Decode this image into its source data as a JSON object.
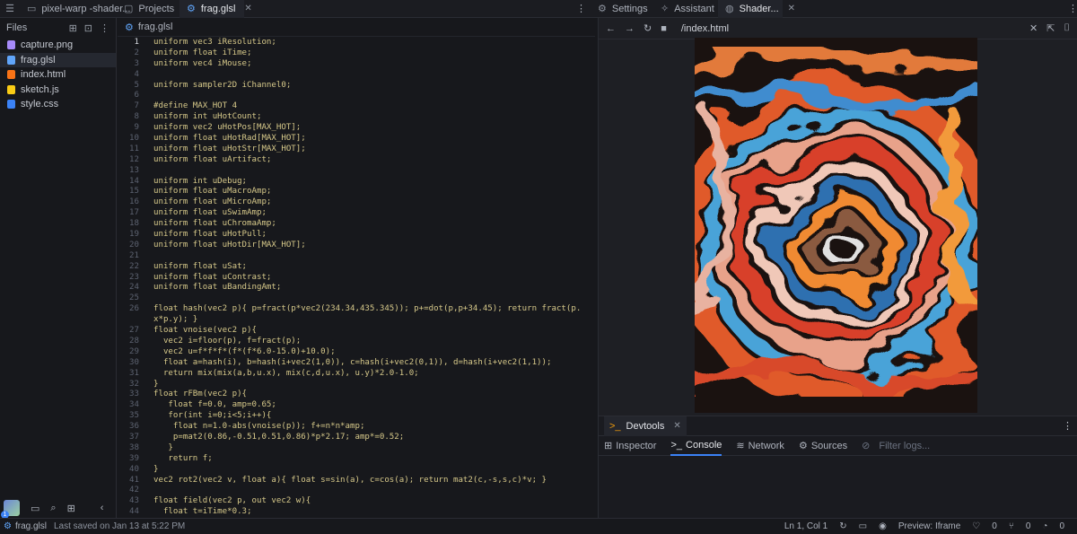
{
  "topbar": {
    "project_tab": "pixel-warp -shader...",
    "projects_tab": "Projects",
    "file_tab": "frag.glsl",
    "settings_tab": "Settings",
    "assistant_tab": "Assistant",
    "shader_tab": "Shader..."
  },
  "sidebar": {
    "title": "Files",
    "files": [
      {
        "name": "capture.png",
        "color": "#a78bfa"
      },
      {
        "name": "frag.glsl",
        "color": "#60a5fa"
      },
      {
        "name": "index.html",
        "color": "#f97316"
      },
      {
        "name": "sketch.js",
        "color": "#facc15"
      },
      {
        "name": "style.css",
        "color": "#3b82f6"
      }
    ],
    "avatar_badge": "1"
  },
  "editor": {
    "breadcrumb": "frag.glsl",
    "lines": [
      {
        "n": "1",
        "t": "uniform vec3 iResolution;"
      },
      {
        "n": "2",
        "t": "uniform float iTime;"
      },
      {
        "n": "3",
        "t": "uniform vec4 iMouse;"
      },
      {
        "n": "4",
        "t": ""
      },
      {
        "n": "5",
        "t": "uniform sampler2D iChannel0;"
      },
      {
        "n": "6",
        "t": ""
      },
      {
        "n": "7",
        "t": "#define MAX_HOT 4"
      },
      {
        "n": "8",
        "t": "uniform int uHotCount;"
      },
      {
        "n": "9",
        "t": "uniform vec2 uHotPos[MAX_HOT];"
      },
      {
        "n": "10",
        "t": "uniform float uHotRad[MAX_HOT];"
      },
      {
        "n": "11",
        "t": "uniform float uHotStr[MAX_HOT];"
      },
      {
        "n": "12",
        "t": "uniform float uArtifact;"
      },
      {
        "n": "13",
        "t": ""
      },
      {
        "n": "14",
        "t": "uniform int uDebug;"
      },
      {
        "n": "15",
        "t": "uniform float uMacroAmp;"
      },
      {
        "n": "16",
        "t": "uniform float uMicroAmp;"
      },
      {
        "n": "17",
        "t": "uniform float uSwimAmp;"
      },
      {
        "n": "18",
        "t": "uniform float uChromaAmp;"
      },
      {
        "n": "19",
        "t": "uniform float uHotPull;"
      },
      {
        "n": "20",
        "t": "uniform float uHotDir[MAX_HOT];"
      },
      {
        "n": "21",
        "t": ""
      },
      {
        "n": "22",
        "t": "uniform float uSat;"
      },
      {
        "n": "23",
        "t": "uniform float uContrast;"
      },
      {
        "n": "24",
        "t": "uniform float uBandingAmt;"
      },
      {
        "n": "25",
        "t": ""
      },
      {
        "n": "26",
        "t": "float hash(vec2 p){ p=fract(p*vec2(234.34,435.345)); p+=dot(p,p+34.45); return fract(p."
      },
      {
        "n": "",
        "t": "x*p.y); }"
      },
      {
        "n": "27",
        "t": "float vnoise(vec2 p){"
      },
      {
        "n": "28",
        "t": "  vec2 i=floor(p), f=fract(p);"
      },
      {
        "n": "29",
        "t": "  vec2 u=f*f*f*(f*(f*6.0-15.0)+10.0);"
      },
      {
        "n": "30",
        "t": "  float a=hash(i), b=hash(i+vec2(1,0)), c=hash(i+vec2(0,1)), d=hash(i+vec2(1,1));"
      },
      {
        "n": "31",
        "t": "  return mix(mix(a,b,u.x), mix(c,d,u.x), u.y)*2.0-1.0;"
      },
      {
        "n": "32",
        "t": "}"
      },
      {
        "n": "33",
        "t": "float rFBm(vec2 p){"
      },
      {
        "n": "34",
        "t": "   float f=0.0, amp=0.65;"
      },
      {
        "n": "35",
        "t": "   for(int i=0;i<5;i++){"
      },
      {
        "n": "36",
        "t": "    float n=1.0-abs(vnoise(p)); f+=n*n*amp;"
      },
      {
        "n": "37",
        "t": "    p=mat2(0.86,-0.51,0.51,0.86)*p*2.17; amp*=0.52;"
      },
      {
        "n": "38",
        "t": "   }"
      },
      {
        "n": "39",
        "t": "   return f;"
      },
      {
        "n": "40",
        "t": "}"
      },
      {
        "n": "41",
        "t": "vec2 rot2(vec2 v, float a){ float s=sin(a), c=cos(a); return mat2(c,-s,s,c)*v; }"
      },
      {
        "n": "42",
        "t": ""
      },
      {
        "n": "43",
        "t": "float field(vec2 p, out vec2 w){"
      },
      {
        "n": "44",
        "t": "  float t=iTime*0.3;"
      }
    ]
  },
  "preview": {
    "url": "/index.html"
  },
  "devtools": {
    "title": "Devtools",
    "tabs": [
      "Inspector",
      "Console",
      "Network",
      "Sources"
    ],
    "filter_placeholder": "Filter logs..."
  },
  "status": {
    "file": "frag.glsl",
    "saved": "Last saved on Jan 13 at 5:22 PM",
    "position": "Ln 1, Col 1",
    "preview_mode": "Preview: Iframe",
    "count_a": "0",
    "count_b": "0",
    "count_c": "0"
  }
}
